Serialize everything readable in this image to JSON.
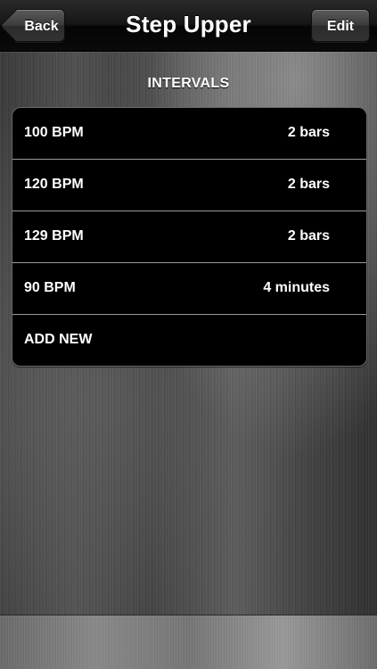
{
  "nav": {
    "title": "Step Upper",
    "back_label": "Back",
    "edit_label": "Edit"
  },
  "section": {
    "header": "INTERVALS"
  },
  "intervals": [
    {
      "tempo": "100 BPM",
      "duration": "2 bars"
    },
    {
      "tempo": "120 BPM",
      "duration": "2 bars"
    },
    {
      "tempo": "129 BPM",
      "duration": "2 bars"
    },
    {
      "tempo": "90 BPM",
      "duration": "4 minutes"
    }
  ],
  "add_new_label": "ADD NEW"
}
